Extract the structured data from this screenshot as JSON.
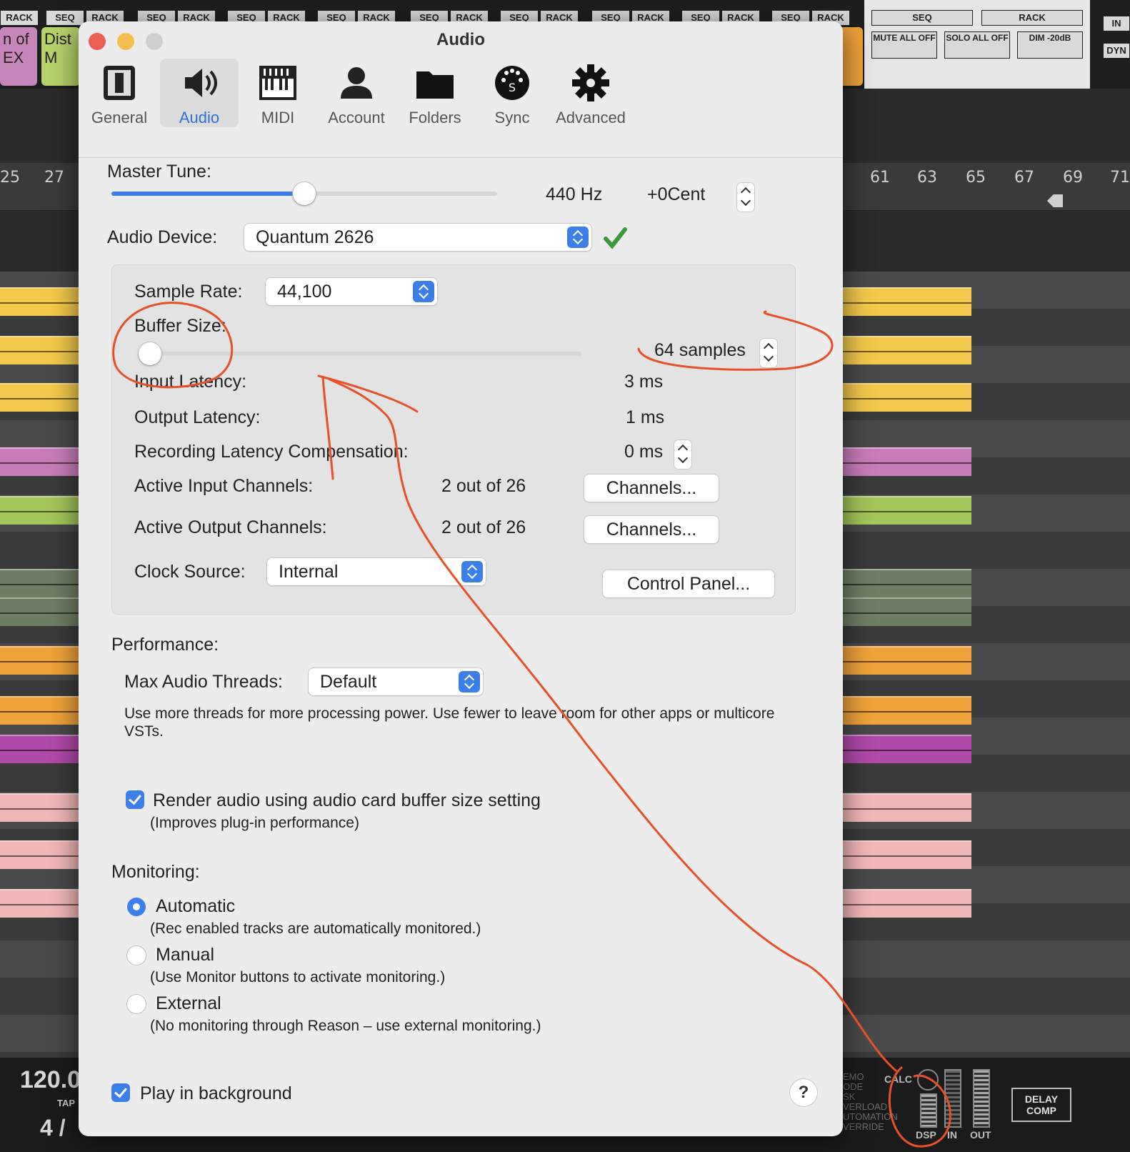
{
  "window": {
    "title": "Audio"
  },
  "toolbar": {
    "tabs": [
      {
        "label": "General",
        "icon": "general-icon",
        "active": false
      },
      {
        "label": "Audio",
        "icon": "speaker-icon",
        "active": true
      },
      {
        "label": "MIDI",
        "icon": "midi-icon",
        "active": false
      },
      {
        "label": "Account",
        "icon": "account-icon",
        "active": false
      },
      {
        "label": "Folders",
        "icon": "folder-icon",
        "active": false
      },
      {
        "label": "Sync",
        "icon": "sync-icon",
        "active": false
      },
      {
        "label": "Advanced",
        "icon": "gear-icon",
        "active": false
      }
    ]
  },
  "master_tune": {
    "label": "Master Tune:",
    "hz": "440 Hz",
    "cent": "+0Cent",
    "slider_fraction": 0.5
  },
  "audio_device": {
    "label": "Audio Device:",
    "value": "Quantum 2626",
    "status_icon": "green-check-icon"
  },
  "sample_rate": {
    "label": "Sample Rate:",
    "value": "44,100"
  },
  "buffer_size": {
    "label": "Buffer Size:",
    "value": "64 samples",
    "slider_fraction": 0.0
  },
  "input_latency": {
    "label": "Input Latency:",
    "value": "3 ms"
  },
  "output_latency": {
    "label": "Output Latency:",
    "value": "1 ms"
  },
  "recording_latency": {
    "label": "Recording Latency Compensation:",
    "value": "0 ms"
  },
  "active_input": {
    "label": "Active Input Channels:",
    "value": "2 out of 26",
    "button": "Channels..."
  },
  "active_output": {
    "label": "Active Output Channels:",
    "value": "2 out of 26",
    "button": "Channels..."
  },
  "clock_source": {
    "label": "Clock Source:",
    "value": "Internal",
    "button": "Control Panel..."
  },
  "performance": {
    "heading": "Performance:",
    "threads_label": "Max Audio Threads:",
    "threads_value": "Default",
    "description": "Use more threads for more processing power. Use fewer to leave room for other apps or multicore VSTs."
  },
  "render": {
    "label": "Render audio using audio card buffer size setting",
    "sub": "(Improves plug-in performance)",
    "checked": true
  },
  "monitoring": {
    "heading": "Monitoring:",
    "options": [
      {
        "label": "Automatic",
        "sub": "(Rec enabled tracks are automatically monitored.)",
        "selected": true
      },
      {
        "label": "Manual",
        "sub": "(Use Monitor buttons to activate monitoring.)",
        "selected": false
      },
      {
        "label": "External",
        "sub": "(No monitoring through Reason – use external monitoring.)",
        "selected": false
      }
    ]
  },
  "play_background": {
    "label": "Play in background",
    "checked": true
  },
  "help": {
    "label": "?"
  },
  "daw": {
    "seq": "SEQ",
    "rack": "RACK",
    "mute_all": "MUTE ALL OFF",
    "solo_all": "SOLO ALL OFF",
    "dim": "DIM -20dB",
    "in": "IN",
    "dyn": "DYN",
    "track1": "n of EX",
    "track2": "Dist M",
    "ruler": [
      "25",
      "27",
      "61",
      "63",
      "65",
      "67",
      "69",
      "71"
    ],
    "tempo": "120.0",
    "tap": "TAP",
    "signature": "4 /",
    "calc": "CALC",
    "dsp": "DSP",
    "meter_in": "IN",
    "meter_out": "OUT",
    "delay_comp": "DELAY COMP",
    "status_lines": [
      "EMO",
      "ODE",
      "SK",
      "VERLOAD",
      "UTOMATION",
      "VERRIDE"
    ]
  },
  "colors": {
    "accent": "#3d7fe8",
    "annotation": "#e8502a",
    "clip_yellow": "#f2c94c",
    "clip_pink": "#c77dbb",
    "clip_green": "#a3c65a",
    "clip_orange": "#f0a23a"
  }
}
